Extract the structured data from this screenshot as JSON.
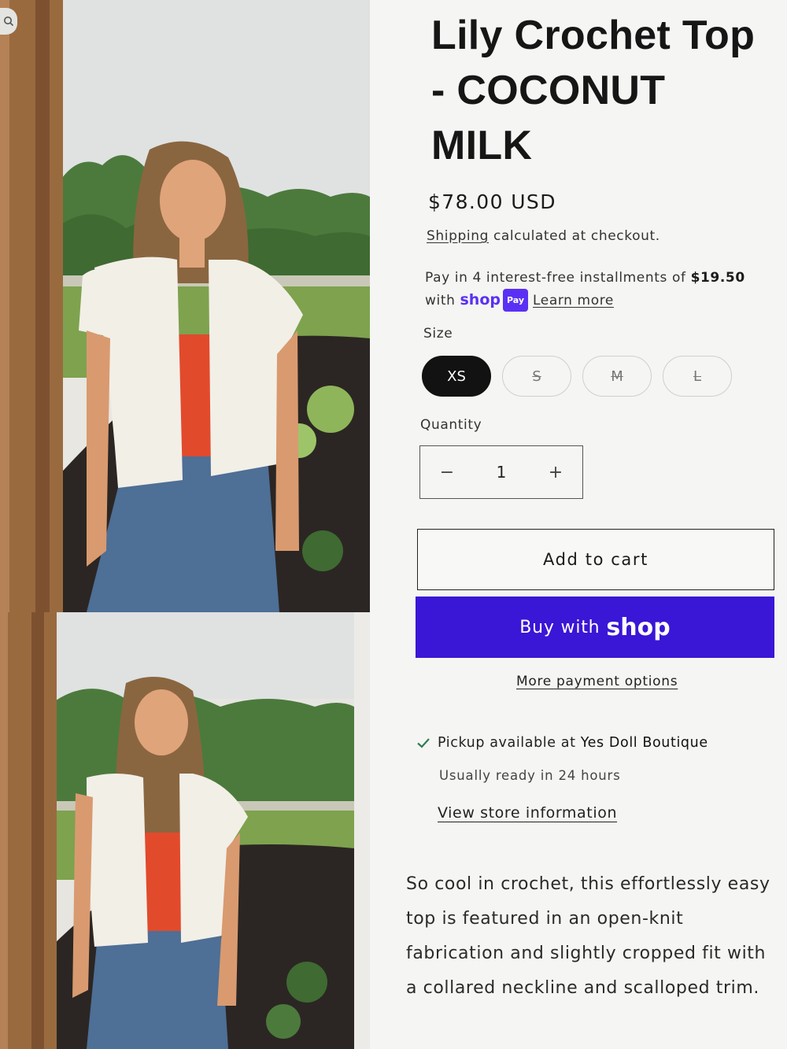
{
  "product": {
    "title": "Lily Crochet Top\n- COCONUT\nMILK",
    "price": "$78.00 USD",
    "shipping_link": "Shipping",
    "shipping_rest": " calculated at checkout.",
    "installments_text": "Pay in 4 interest-free installments of ",
    "installment_amount": "$19.50",
    "installments_with": "with ",
    "shop_pay_word": "shop",
    "shop_pay_badge": "Pay",
    "learn_more": "Learn more"
  },
  "size": {
    "label": "Size",
    "options": [
      {
        "label": "XS",
        "selected": true,
        "sold_out": false
      },
      {
        "label": "S",
        "selected": false,
        "sold_out": true
      },
      {
        "label": "M",
        "selected": false,
        "sold_out": true
      },
      {
        "label": "L",
        "selected": false,
        "sold_out": true
      }
    ]
  },
  "quantity": {
    "label": "Quantity",
    "value": "1",
    "decrement": "−",
    "increment": "+"
  },
  "actions": {
    "add_to_cart": "Add to cart",
    "buy_with": "Buy with",
    "shop_logo": "shop",
    "more_payment": "More payment options"
  },
  "pickup": {
    "prefix": "Pickup available at ",
    "store": "Yes Doll Boutique",
    "ready": "Usually ready in 24 hours",
    "view_store": "View store information"
  },
  "description": "So cool in crochet, this effortlessly easy top is featured in an open-knit fabrication and slightly cropped fit with a collared neckline and scalloped trim.",
  "icons": {
    "search": "search-icon",
    "check": "check-icon"
  },
  "colors": {
    "shop_purple": "#5a31f4",
    "buy_button": "#3a16d6",
    "selected_size": "#121212",
    "check_green": "#2e7d4f"
  }
}
